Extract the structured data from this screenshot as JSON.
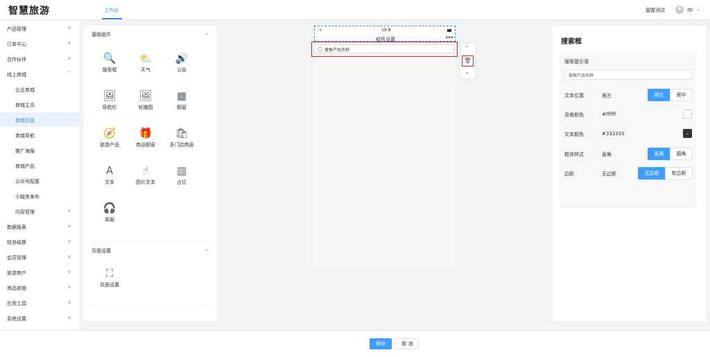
{
  "app": {
    "logo": "智慧旅游",
    "top_tab": "工作台",
    "user_label": "雷霆测试",
    "user_name": "zp"
  },
  "sidebar": {
    "items": [
      {
        "label": "产品管理",
        "chevron": "v"
      },
      {
        "label": "订单中心",
        "chevron": "v"
      },
      {
        "label": "合作伙伴",
        "chevron": "v"
      },
      {
        "label": "线上商城",
        "chevron": "^"
      },
      {
        "label": "企业商城"
      },
      {
        "label": "商城主页"
      },
      {
        "label": "商城页面"
      },
      {
        "label": "商城导航"
      },
      {
        "label": "推广海报"
      },
      {
        "label": "商城产品"
      },
      {
        "label": "公众号配置"
      },
      {
        "label": "小程序发布"
      },
      {
        "label": "内容管理",
        "chevron": "v"
      },
      {
        "label": "数据报表",
        "chevron": "v"
      },
      {
        "label": "财务结算",
        "chevron": "v"
      },
      {
        "label": "会员管理",
        "chevron": "v"
      },
      {
        "label": "旅游商户",
        "chevron": "v"
      },
      {
        "label": "商品收银",
        "chevron": "v"
      },
      {
        "label": "应用工具",
        "chevron": "v"
      },
      {
        "label": "系统设置",
        "chevron": "v"
      }
    ]
  },
  "components": {
    "basic_title": "基础组件",
    "basic": [
      {
        "label": "搜索框",
        "icon": "search-icon",
        "glyph": "🔍"
      },
      {
        "label": "天气",
        "icon": "weather-icon",
        "glyph": "⛅"
      },
      {
        "label": "公告",
        "icon": "speaker-icon",
        "glyph": "🔊"
      },
      {
        "label": "导航栏",
        "icon": "image-icon",
        "glyph": "🖼"
      },
      {
        "label": "轮播图",
        "icon": "carousel-icon",
        "glyph": "🖼"
      },
      {
        "label": "橱窗",
        "icon": "grid-icon",
        "glyph": "▦"
      },
      {
        "label": "旅游产品",
        "icon": "compass-icon",
        "glyph": "🧭"
      },
      {
        "label": "商品橱窗",
        "icon": "gift-icon",
        "glyph": "🎁"
      },
      {
        "label": "多门店商品",
        "icon": "shop-icon",
        "glyph": "🛍"
      },
      {
        "label": "文本",
        "icon": "text-icon",
        "glyph": "A"
      },
      {
        "label": "图片文本",
        "icon": "touch-icon",
        "glyph": "☝"
      },
      {
        "label": "占位",
        "icon": "placeholder-icon",
        "glyph": "▥"
      },
      {
        "label": "客服",
        "icon": "headset-icon",
        "glyph": "🎧"
      }
    ],
    "page_title": "页面设置",
    "page": [
      {
        "label": "页面设置",
        "icon": "page-settings-icon",
        "glyph": "⛶"
      }
    ]
  },
  "phone": {
    "time": "18:8",
    "title": "组件设置",
    "more": "•••",
    "search_placeholder": "搜索产品名称"
  },
  "controls": {
    "up": "⌃",
    "delete": "🗑",
    "down": "⌄"
  },
  "settings": {
    "title": "搜索框",
    "hint_label": "搜索提示语",
    "hint_value": "搜索产品名称",
    "text_position_label": "文本位置",
    "text_position_value": "居左",
    "text_position_options": [
      "居左",
      "居中"
    ],
    "bg_color_label": "背景颜色",
    "bg_color_value": "#ffffff",
    "text_color_label": "文本颜色",
    "text_color_value": "#333333",
    "box_style_label": "框体样式",
    "box_style_value": "直角",
    "box_style_options": [
      "直角",
      "圆角"
    ],
    "margin_label": "边距",
    "margin_value": "无边距",
    "margin_options": [
      "无边距",
      "有边距"
    ]
  },
  "footer": {
    "save": "保存",
    "cancel": "取 消"
  },
  "colors": {
    "accent": "#409eff",
    "highlight": "#e02020"
  }
}
